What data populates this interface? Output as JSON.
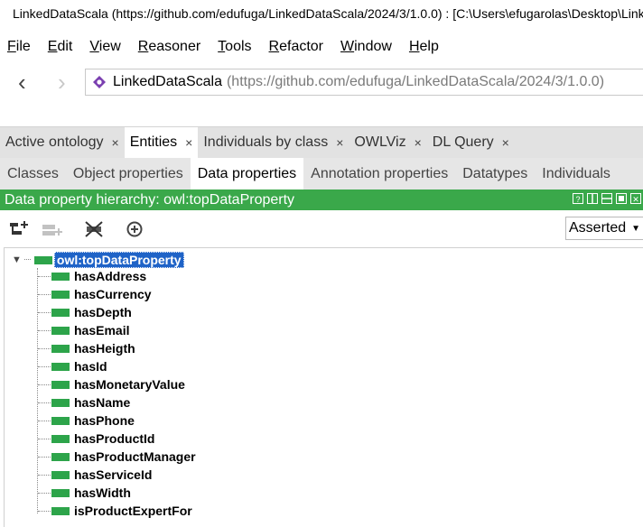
{
  "window": {
    "title": "LinkedDataScala (https://github.com/edufuga/LinkedDataScala/2024/3/1.0.0)  : [C:\\Users\\efugarolas\\Desktop\\LinkedDataScala.ttl]"
  },
  "menu": [
    "File",
    "Edit",
    "View",
    "Reasoner",
    "Tools",
    "Refactor",
    "Window",
    "Help"
  ],
  "menu_mnemonics": [
    "F",
    "E",
    "V",
    "R",
    "T",
    "R",
    "W",
    "H"
  ],
  "navigation": {
    "back_icon": "chevron-left-icon",
    "forward_icon": "chevron-right-icon",
    "ontology_name": "LinkedDataScala",
    "ontology_iri": "(https://github.com/edufuga/LinkedDataScala/2024/3/1.0.0)"
  },
  "workspace_tabs": [
    {
      "label": "Active ontology",
      "active": false
    },
    {
      "label": "Entities",
      "active": true
    },
    {
      "label": "Individuals by class",
      "active": false
    },
    {
      "label": "OWLViz",
      "active": false
    },
    {
      "label": "DL Query",
      "active": false
    }
  ],
  "close_glyph": "×",
  "entity_tabs": [
    {
      "label": "Classes",
      "active": false
    },
    {
      "label": "Object properties",
      "active": false
    },
    {
      "label": "Data properties",
      "active": true
    },
    {
      "label": "Annotation properties",
      "active": false
    },
    {
      "label": "Datatypes",
      "active": false
    },
    {
      "label": "Individuals",
      "active": false
    }
  ],
  "view": {
    "title": "Data property hierarchy: owl:topDataProperty",
    "header_color": "#3aa84a",
    "header_buttons": [
      "help-icon",
      "split-vertical-icon",
      "split-horizontal-icon",
      "maximize-icon",
      "close-icon"
    ],
    "inference_mode": "Asserted"
  },
  "toolbar_icons": [
    "add-sub-property-icon",
    "add-sibling-property-icon",
    "delete-property-icon",
    "find-usage-icon"
  ],
  "tree": {
    "root": "owl:topDataProperty",
    "property_color": "#2da44a",
    "selection_color": "#1f63c7",
    "children": [
      "hasAddress",
      "hasCurrency",
      "hasDepth",
      "hasEmail",
      "hasHeigth",
      "hasId",
      "hasMonetaryValue",
      "hasName",
      "hasPhone",
      "hasProductId",
      "hasProductManager",
      "hasServiceId",
      "hasWidth",
      "isProductExpertFor"
    ]
  }
}
